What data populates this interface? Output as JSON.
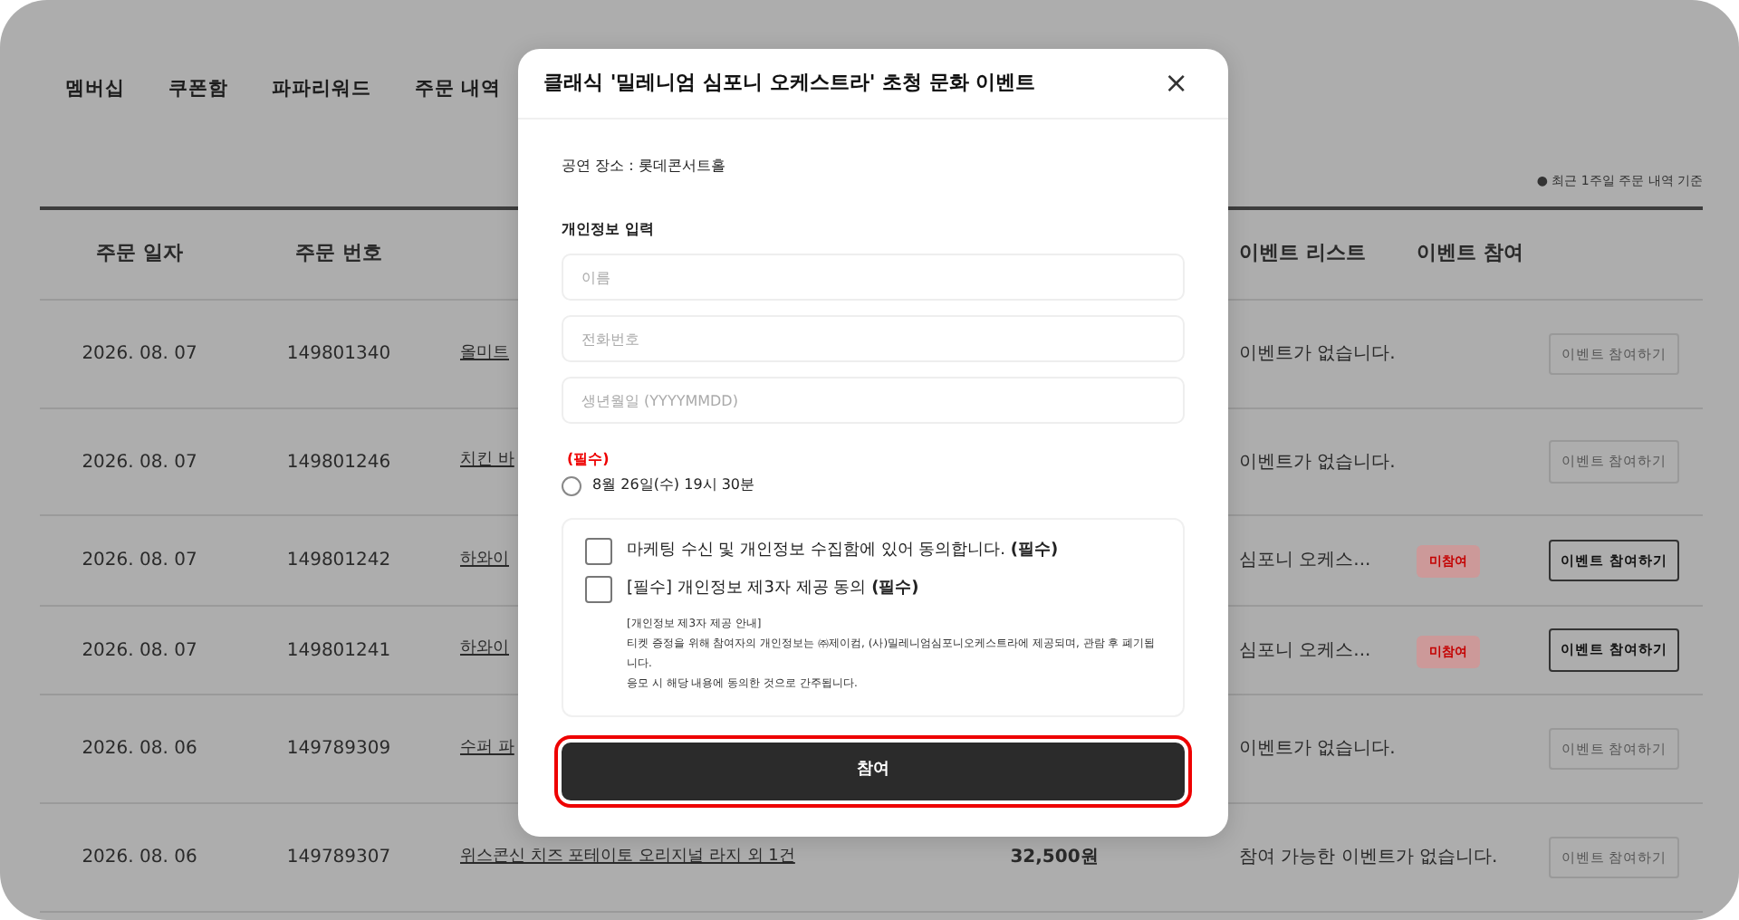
{
  "tabs": [
    {
      "label": "멤버십"
    },
    {
      "label": "쿠폰함"
    },
    {
      "label": "파파리워드"
    },
    {
      "label": "주문 내역"
    }
  ],
  "note": "● 최근 1주일 주문 내역 기준",
  "table": {
    "columns": [
      "주문 일자",
      "주문 번호",
      "",
      "",
      "이벤트 리스트",
      "이벤트 참여"
    ],
    "rows": [
      {
        "date": "2026. 08. 07",
        "number": "149801340",
        "product": "올미트",
        "price": "",
        "event": "이벤트가 없습니다.",
        "badge": "",
        "button": "이벤트 참여하기",
        "disabled": true
      },
      {
        "date": "2026. 08. 07",
        "number": "149801246",
        "product": "치킨 바",
        "price": "",
        "event": "이벤트가 없습니다.",
        "badge": "",
        "button": "이벤트 참여하기",
        "disabled": true
      },
      {
        "date": "2026. 08. 07",
        "number": "149801242",
        "product": "하와이",
        "price": "",
        "event": "심포니 오케스...",
        "badge": "미참여",
        "button": "이벤트 참여하기",
        "disabled": false
      },
      {
        "date": "2026. 08. 07",
        "number": "149801241",
        "product": "하와이",
        "price": "",
        "event": "심포니 오케스...",
        "badge": "미참여",
        "button": "이벤트 참여하기",
        "disabled": false
      },
      {
        "date": "2026. 08. 06",
        "number": "149789309",
        "product": "수퍼 파",
        "price": "",
        "event": "이벤트가 없습니다.",
        "badge": "",
        "button": "이벤트 참여하기",
        "disabled": true
      },
      {
        "date": "2026. 08. 06",
        "number": "149789307",
        "product": "위스콘신 치즈 포테이토 오리지널 라지 외 1건",
        "price": "32,500원",
        "event": "참여 가능한 이벤트가 없습니다.",
        "badge": "",
        "button": "이벤트 참여하기",
        "disabled": true
      }
    ]
  },
  "modal": {
    "title": "클래식 '밀레니엄 심포니 오케스트라' 초청 문화 이벤트",
    "close": "×",
    "venue": "공연 장소 : 롯데콘서트홀",
    "section": "개인정보 입력",
    "fields": [
      {
        "placeholder": "이름"
      },
      {
        "placeholder": "전화번호"
      },
      {
        "placeholder": "생년월일 (YYYYMMDD)"
      }
    ],
    "required_label": "(필수)",
    "options": [
      {
        "label": "8월 26일(수) 19시 30분",
        "selected": false
      }
    ],
    "agreements": [
      {
        "label": "마케팅 수신 및 개인정보 수집함에 있어 동의합니다. **(필수)**",
        "checked": false
      },
      {
        "label": "[필수] 개인정보 제3자 제공 동의 **(필수)**",
        "checked": false
      }
    ],
    "notice": [
      "[개인정보 제3자 제공 안내]",
      "티켓 증정을 위해 참여자의 개인정보는 ㈜제이컴, (사)밀레니엄심포니오케스트라에 제공되며, 관람 후 폐기됩니다.",
      "응모 시 해당 내용에 동의한 것으로 간주됩니다."
    ],
    "submit": "참여",
    "submit_highlighted": true
  }
}
